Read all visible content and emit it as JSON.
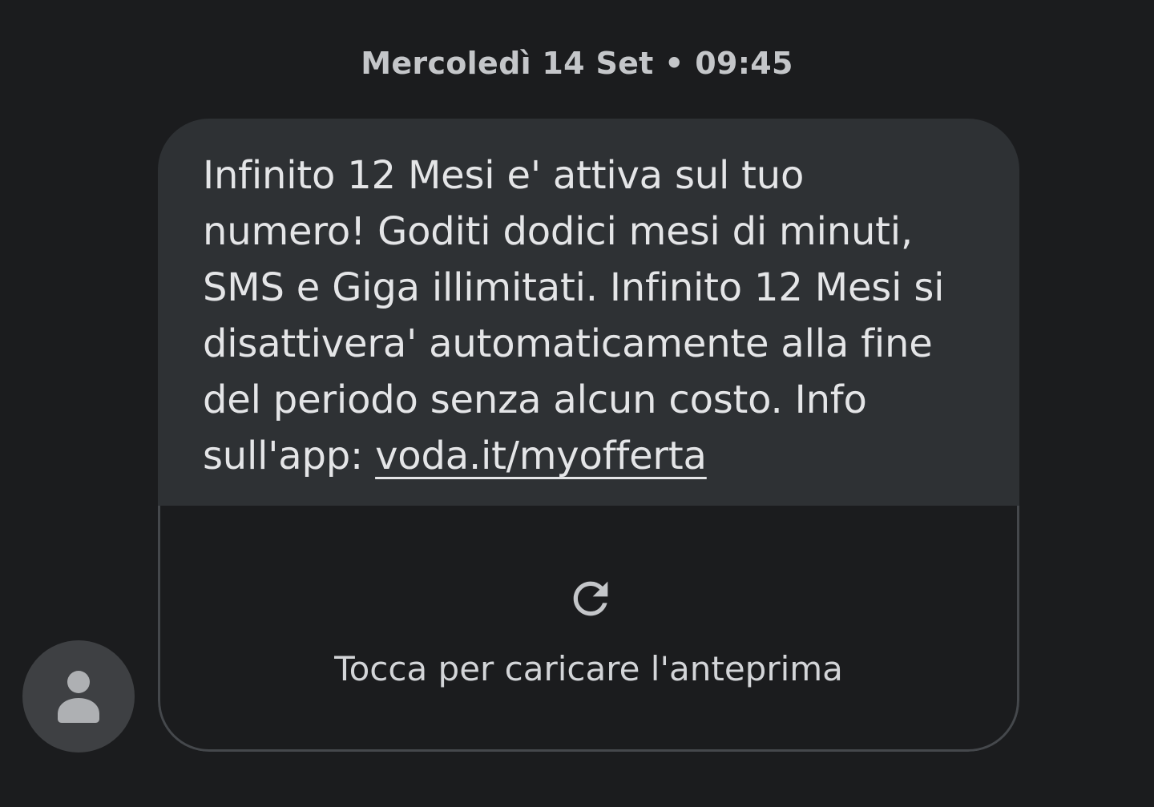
{
  "header": {
    "timestamp": "Mercoledì 14 Set • 09:45"
  },
  "message": {
    "lines": [
      "Infinito 12 Mesi e' attiva sul tuo",
      "numero! Goditi dodici mesi di minuti,",
      "SMS e Giga illimitati. Infinito 12 Mesi si",
      "disattivera' automaticamente alla fine",
      "del periodo senza alcun costo. Info"
    ],
    "last_line_prefix": "sull'app: ",
    "link_text": "voda.it/myofferta"
  },
  "preview": {
    "label": "Tocca per caricare l'anteprima",
    "icon": "refresh-icon"
  },
  "sender": {
    "avatar_icon": "person-icon"
  },
  "colors": {
    "background": "#1b1c1e",
    "bubble": "#2e3134",
    "text": "#e4e5e7",
    "avatar": "#3e4043"
  }
}
